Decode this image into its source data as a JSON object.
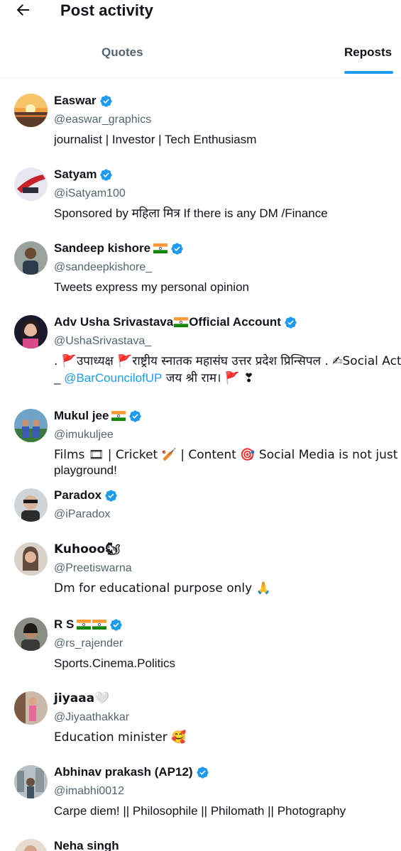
{
  "header": {
    "title": "Post activity"
  },
  "tabs": [
    {
      "label": "Quotes"
    },
    {
      "label": "Reposts"
    }
  ],
  "colors": {
    "accent": "#1d9bf0",
    "secondary_text": "#536471",
    "verified": "#1d9bf0"
  },
  "users": [
    {
      "name": "Easwar",
      "handle": "@easwar_graphics",
      "bio": "journalist | Investor | Tech Enthusiasm",
      "verified": true
    },
    {
      "name": "Satyam",
      "handle": "@iSatyam100",
      "bio": "Sponsored by महिला मित्र If there is any DM /Finance",
      "verified": true
    },
    {
      "name": "Sandeep kishore",
      "handle": "@sandeepkishore_",
      "bio": "Tweets express my personal opinion",
      "verified": true,
      "flags": 1
    },
    {
      "name": "Adv Usha Srivastava",
      "name_suffix": "Official Account",
      "handle": "@UshaSrivastava_",
      "bio_line1": ". 🚩उपाध्यक्ष 🚩राष्ट्रीय स्नातक महासंघ उत्तर प्रदेश प्रिन्सिपल . ✍Social Activist",
      "bio_line2_prefix": "_ ",
      "bio_link": "@BarCouncilofUP",
      "bio_line2_suffix": " जय श्री राम। 🚩 ❣",
      "verified": true,
      "flags": 1
    },
    {
      "name": "Mukul jee",
      "handle": "@imukuljee",
      "bio_line1": "Films 🎞 | Cricket 🏏 | Content 🎯 Social Media is not just fun",
      "bio_line2": "playground!",
      "verified": true,
      "flags": 1
    },
    {
      "name": "Paradox",
      "handle": "@iParadox",
      "verified": true
    },
    {
      "name": "Kuhooo🐿",
      "handle": "@Preetiswarna",
      "bio": "Dm for educational purpose only 🙏",
      "verified": false
    },
    {
      "name": "R S",
      "handle": "@rs_rajender",
      "bio": "Sports.Cinema.Politics",
      "verified": true,
      "flags": 2
    },
    {
      "name": "jiyaaa🤍",
      "handle": "@Jiyaathakkar",
      "bio": "Education minister 🥰",
      "verified": false
    },
    {
      "name": "Abhinav prakash (AP12)",
      "handle": "@imabhi0012",
      "bio": "Carpe diem! || Philosophile || Philomath || Photography",
      "verified": true
    },
    {
      "name": "Neha singh"
    }
  ]
}
